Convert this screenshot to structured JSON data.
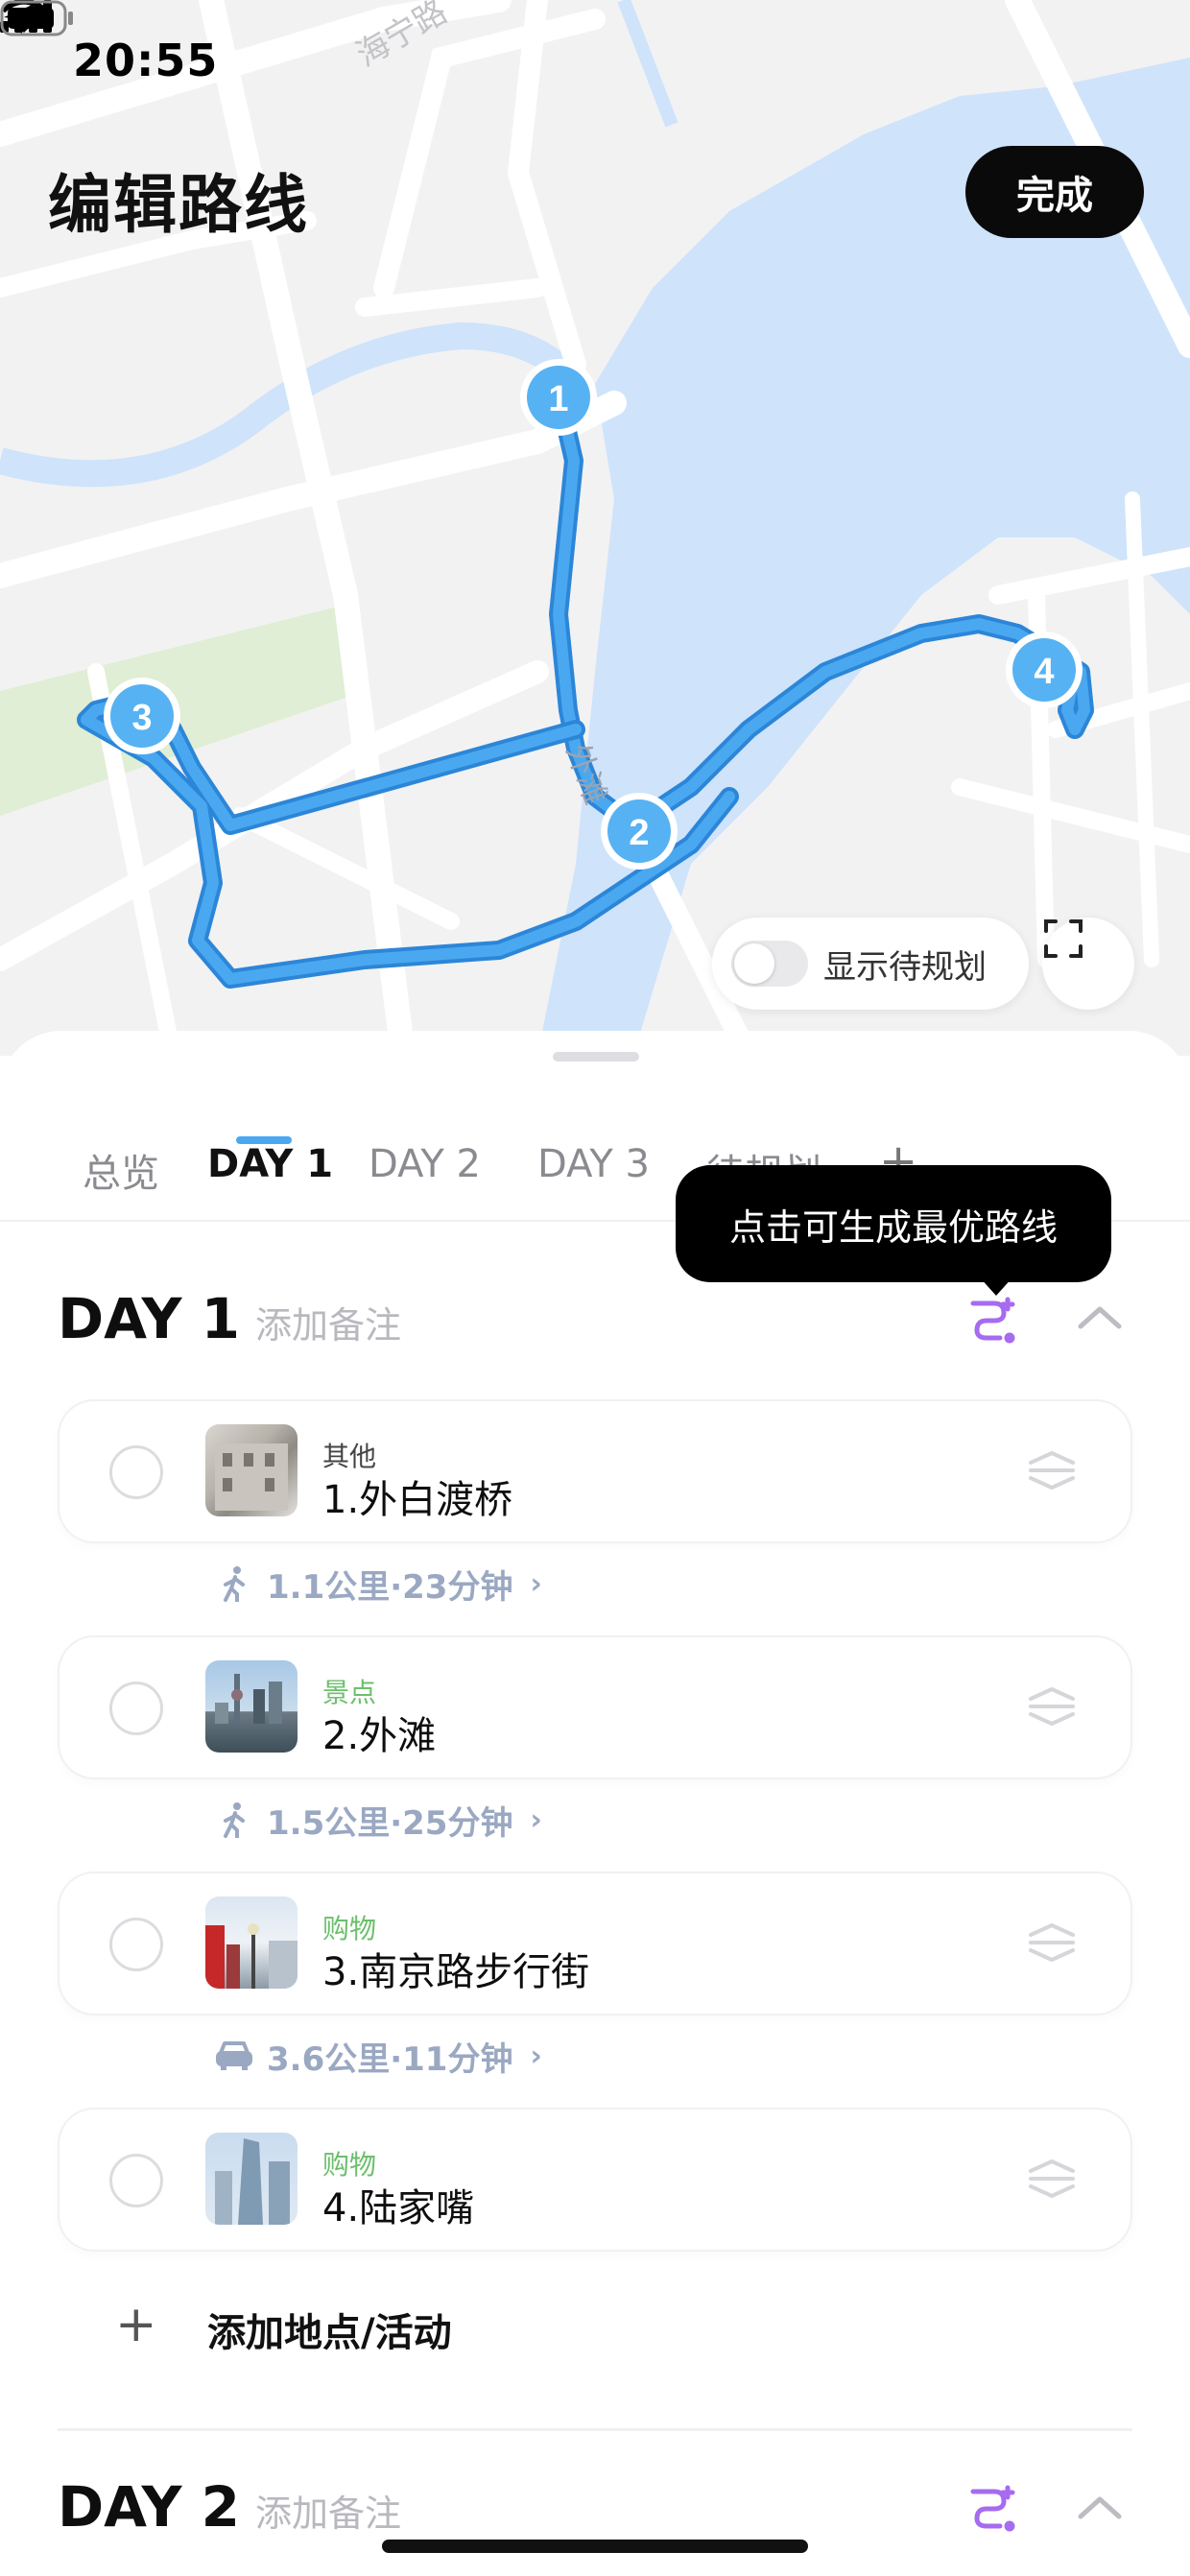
{
  "status_bar": {
    "time": "20:55"
  },
  "header": {
    "title": "编辑路线",
    "done_label": "完成"
  },
  "map": {
    "road_label": "海宁路",
    "bund_label": "外滩",
    "markers": [
      "1",
      "2",
      "3",
      "4"
    ],
    "show_unplanned_label": "显示待规划",
    "route_color": "#4aa8f0",
    "water_color": "#cfe3fb",
    "park_color": "#dfeed4"
  },
  "tabs": [
    "总览",
    "DAY 1",
    "DAY 2",
    "DAY 3",
    "待规划",
    "+"
  ],
  "active_tab": "DAY 1",
  "tooltip": "点击可生成最优路线",
  "day1": {
    "title": "DAY 1",
    "note_placeholder": "添加备注",
    "stops": [
      {
        "category": "其他",
        "category_color": "#444444",
        "name": "1.外白渡桥"
      },
      {
        "category": "景点",
        "category_color": "#6cbf6c",
        "name": "2.外滩"
      },
      {
        "category": "购物",
        "category_color": "#6cbf6c",
        "name": "3.南京路步行街"
      },
      {
        "category": "购物",
        "category_color": "#6cbf6c",
        "name": "4.陆家嘴"
      }
    ],
    "legs": [
      {
        "mode": "walk-icon",
        "text": "1.1公里·23分钟"
      },
      {
        "mode": "walk-icon",
        "text": "1.5公里·25分钟"
      },
      {
        "mode": "car-icon",
        "text": "3.6公里·11分钟"
      }
    ],
    "add_label": "添加地点/活动"
  },
  "day2": {
    "title": "DAY 2",
    "note_placeholder": "添加备注"
  },
  "accent_color": "#a66bf0"
}
